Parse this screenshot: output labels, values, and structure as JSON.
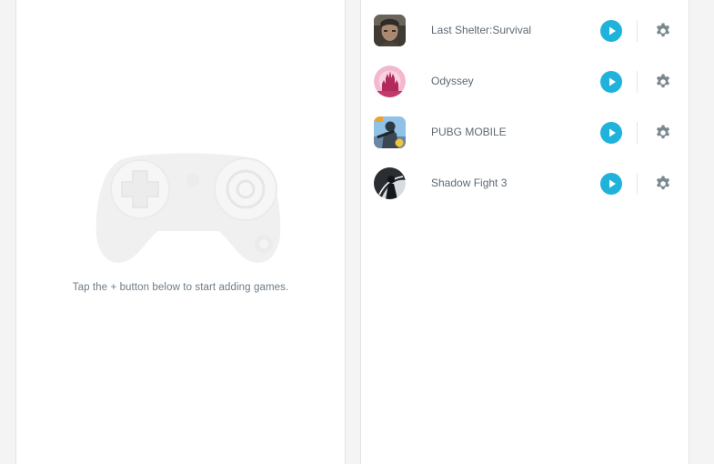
{
  "empty_state": {
    "message": "Tap the + button below to start adding games.",
    "illustration_icon": "gamepad-icon"
  },
  "games": [
    {
      "name": "Last Shelter:Survival",
      "icon": "last-shelter-icon",
      "actions": [
        "play-icon",
        "gear-icon"
      ]
    },
    {
      "name": "Odyssey",
      "icon": "odyssey-icon",
      "actions": [
        "play-icon",
        "gear-icon"
      ]
    },
    {
      "name": "PUBG MOBILE",
      "icon": "pubg-mobile-icon",
      "actions": [
        "play-icon",
        "gear-icon"
      ]
    },
    {
      "name": "Shadow Fight 3",
      "icon": "shadow-fight-icon",
      "actions": [
        "play-icon",
        "gear-icon"
      ]
    }
  ],
  "colors": {
    "background": "#f4f4f4",
    "panel": "#ffffff",
    "accent_play": "#1fb3dc",
    "text": "#5d6a74",
    "icon_gray": "#7b8890",
    "illustration": "#f0f0f0"
  }
}
